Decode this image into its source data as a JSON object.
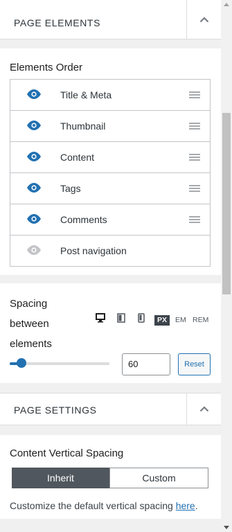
{
  "page_elements": {
    "header_title": "PAGE ELEMENTS",
    "order_label": "Elements Order",
    "items": [
      {
        "label": "Title & Meta",
        "visible": true,
        "draggable": true
      },
      {
        "label": "Thumbnail",
        "visible": true,
        "draggable": true
      },
      {
        "label": "Content",
        "visible": true,
        "draggable": true
      },
      {
        "label": "Tags",
        "visible": true,
        "draggable": true
      },
      {
        "label": "Comments",
        "visible": true,
        "draggable": true
      },
      {
        "label": "Post navigation",
        "visible": false,
        "draggable": false
      }
    ]
  },
  "spacing": {
    "label": "Spacing between elements",
    "units": [
      "PX",
      "EM",
      "REM"
    ],
    "active_unit": "PX",
    "devices": [
      "desktop-icon",
      "tablet-icon",
      "mobile-icon"
    ],
    "value": "60",
    "slider_fraction": 0.12,
    "reset_label": "Reset"
  },
  "page_settings": {
    "header_title": "PAGE SETTINGS",
    "vertical_spacing_label": "Content Vertical Spacing",
    "options": [
      "Inherit",
      "Custom"
    ],
    "selected": "Inherit",
    "description": "Customize the default vertical spacing ",
    "description_link": "here",
    "description_end": "."
  },
  "colors": {
    "accent": "#2271b1",
    "active_segment": "#50575e",
    "eye_visible": "#2271b1",
    "eye_hidden": "#c3c4c7"
  }
}
